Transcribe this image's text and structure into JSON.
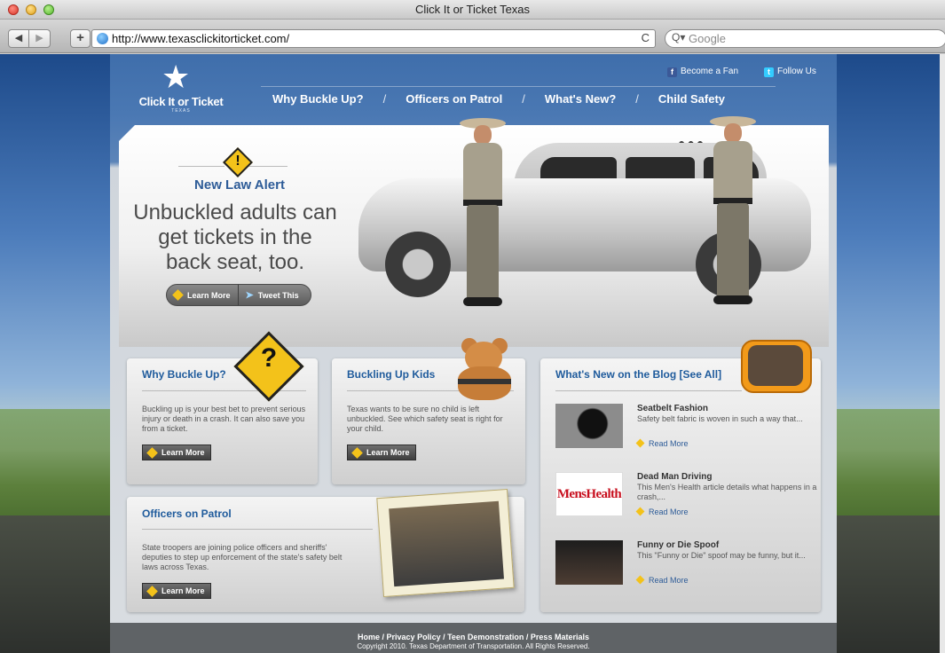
{
  "window": {
    "title": "Click It or Ticket Texas"
  },
  "browser": {
    "back_glyph": "◀",
    "forward_glyph": "▶",
    "add_glyph": "+",
    "url": "http://www.texasclickitorticket.com/",
    "reload_glyph": "C",
    "search_placeholder": "Google",
    "search_glyph": "Q▾"
  },
  "header": {
    "logo_text": "Click It or Ticket",
    "logo_sub": "TEXAS",
    "social": {
      "fan": "Become a Fan",
      "follow": "Follow Us"
    },
    "nav": [
      "Why Buckle Up?",
      "Officers on Patrol",
      "What's New?",
      "Child Safety"
    ]
  },
  "hero": {
    "kicker": "New Law Alert",
    "headline": "Unbuckled adults can get tickets in the back seat, too.",
    "buttons": {
      "learn_more": "Learn More",
      "tweet": "Tweet This"
    },
    "slide_dots": "●●●"
  },
  "panels": {
    "why": {
      "title": "Why Buckle Up?",
      "body": "Buckling up is your best bet to prevent serious injury or death in a crash. It can also save you from a ticket.",
      "button": "Learn More"
    },
    "kids": {
      "title": "Buckling Up Kids",
      "body": "Texas wants to be sure no child is left unbuckled. See which safety seat is right for your child.",
      "button": "Learn More"
    },
    "officers": {
      "title": "Officers on Patrol",
      "body": "State troopers are joining police officers and sheriffs' deputies to step up enforcement of the state's safety belt laws across Texas.",
      "button": "Learn More"
    },
    "blog": {
      "title": "What's New on the Blog [See All]",
      "items": [
        {
          "title": "Seatbelt Fashion",
          "desc": "Safety belt fabric is woven in such a way that...",
          "more": "Read More",
          "thumb": ""
        },
        {
          "title": "Dead Man Driving",
          "desc": "This Men's Health article details what happens in a crash,...",
          "more": "Read More",
          "thumb": "MensHealth"
        },
        {
          "title": "Funny or Die Spoof",
          "desc": "This \"Funny or Die\" spoof may be funny, but it...",
          "more": "Read More",
          "thumb": ""
        }
      ]
    }
  },
  "footer": {
    "links": "Home / Privacy Policy / Teen Demonstration / Press Materials",
    "copyright": "Copyright 2010. Texas Department of Transportation. All Rights Reserved."
  },
  "colors": {
    "brand_blue": "#1f5b9c",
    "accent_yellow": "#f3c21a",
    "header_blue": "#4a78b3"
  }
}
